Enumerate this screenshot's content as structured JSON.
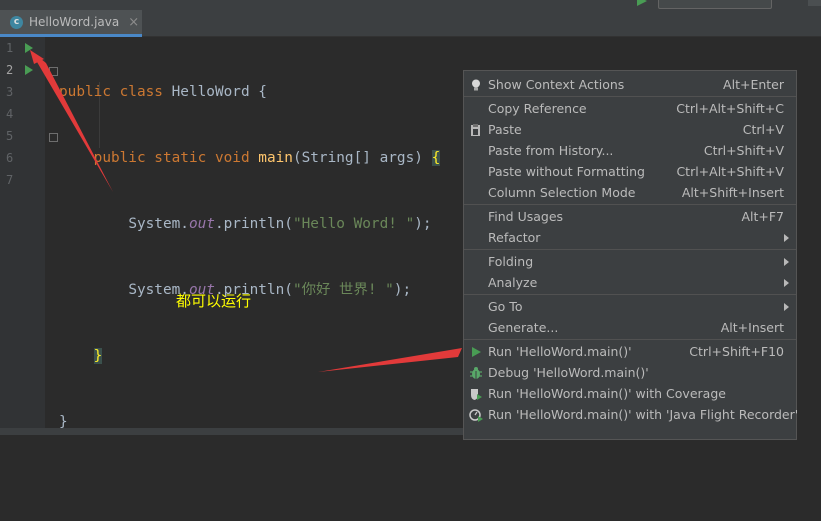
{
  "tab": {
    "file_name": "HelloWord.java",
    "icon_letter": "c",
    "close_glyph": "×"
  },
  "line_numbers": [
    "1",
    "2",
    "3",
    "4",
    "5",
    "6",
    "7"
  ],
  "code": {
    "l1": {
      "kw": "public class ",
      "name": "HelloWord {"
    },
    "l2": {
      "indent": "    ",
      "kw": "public static void ",
      "fn": "main",
      "rest": "(String[] args) ",
      "brace": "{"
    },
    "l3": {
      "indent": "        ",
      "pre": "System.",
      "field": "out",
      "call": ".println(",
      "str": "\"Hello Word! \"",
      "end": ");"
    },
    "l4": {
      "indent": "        ",
      "pre": "System.",
      "field": "out",
      "call": ".println(",
      "str": "\"你好 世界! \"",
      "end": ");"
    },
    "l5": {
      "indent": "    ",
      "brace": "}"
    },
    "l6": {
      "text": "}"
    }
  },
  "annotation": "都可以运行",
  "menu": {
    "show_context_actions": {
      "label": "Show Context Actions",
      "shortcut": "Alt+Enter"
    },
    "copy_reference": {
      "label": "Copy Reference",
      "shortcut": "Ctrl+Alt+Shift+C"
    },
    "paste": {
      "label": "Paste",
      "shortcut": "Ctrl+V"
    },
    "paste_history": {
      "label": "Paste from History...",
      "shortcut": "Ctrl+Shift+V"
    },
    "paste_without_formatting": {
      "label": "Paste without Formatting",
      "shortcut": "Ctrl+Alt+Shift+V"
    },
    "column_selection": {
      "label": "Column Selection Mode",
      "shortcut": "Alt+Shift+Insert"
    },
    "find_usages": {
      "label": "Find Usages",
      "shortcut": "Alt+F7"
    },
    "refactor": {
      "label": "Refactor"
    },
    "folding": {
      "label": "Folding"
    },
    "analyze": {
      "label": "Analyze"
    },
    "go_to": {
      "label": "Go To"
    },
    "generate": {
      "label": "Generate...",
      "shortcut": "Alt+Insert"
    },
    "run": {
      "label": "Run 'HelloWord.main()'",
      "shortcut": "Ctrl+Shift+F10"
    },
    "debug": {
      "label": "Debug 'HelloWord.main()'"
    },
    "coverage": {
      "label": "Run 'HelloWord.main()' with Coverage"
    },
    "flight_recorder": {
      "label": "Run 'HelloWord.main()' with 'Java Flight Recorder'"
    }
  },
  "colors": {
    "editor_bg": "#2b2b2b",
    "menu_bg": "#3c3f41",
    "run_green": "#499c54",
    "annotation_yellow": "#ffff00",
    "arrow_red": "#e23a3a"
  }
}
